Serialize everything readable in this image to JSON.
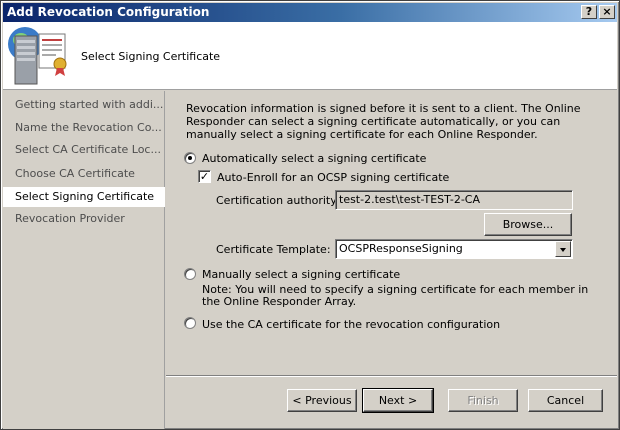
{
  "window": {
    "title": "Add Revocation Configuration",
    "help_button": "?",
    "close_button": "×"
  },
  "header": {
    "title": "Select Signing Certificate",
    "icon": "certificate-server-icon"
  },
  "sidebar": {
    "items": [
      {
        "label": "Getting started with addi..."
      },
      {
        "label": "Name the Revocation Co..."
      },
      {
        "label": "Select CA Certificate Loc..."
      },
      {
        "label": "Choose CA Certificate"
      },
      {
        "label": "Select Signing Certificate"
      },
      {
        "label": "Revocation Provider"
      }
    ]
  },
  "main": {
    "description": "Revocation information is signed before it is sent to a client. The Online Responder can select a signing certificate automatically, or you can manually select a signing certificate for each Online Responder.",
    "auto_select": {
      "label": "Automatically select a signing certificate",
      "checked": true
    },
    "auto_enroll": {
      "label": "Auto-Enroll for an OCSP signing certificate",
      "checked": true
    },
    "ca_label": "Certification authority:",
    "ca_value": "test-2.test\\test-TEST-2-CA",
    "browse_label": "Browse...",
    "template_label": "Certificate Template:",
    "template_value": "OCSPResponseSigning",
    "manual_select": {
      "label": "Manually select a signing certificate",
      "checked": false
    },
    "manual_note_line1": "Note: You will need to specify a signing certificate for each member in",
    "manual_note_line2": "the Online Responder Array.",
    "use_ca": {
      "label": "Use the CA certificate for the revocation configuration",
      "checked": false
    }
  },
  "footer": {
    "previous": "< Previous",
    "next": "Next >",
    "finish": "Finish",
    "cancel": "Cancel"
  },
  "colors": {
    "titlebar_start": "#0a246a",
    "titlebar_end": "#a6caf0",
    "face": "#d4d0c8"
  }
}
